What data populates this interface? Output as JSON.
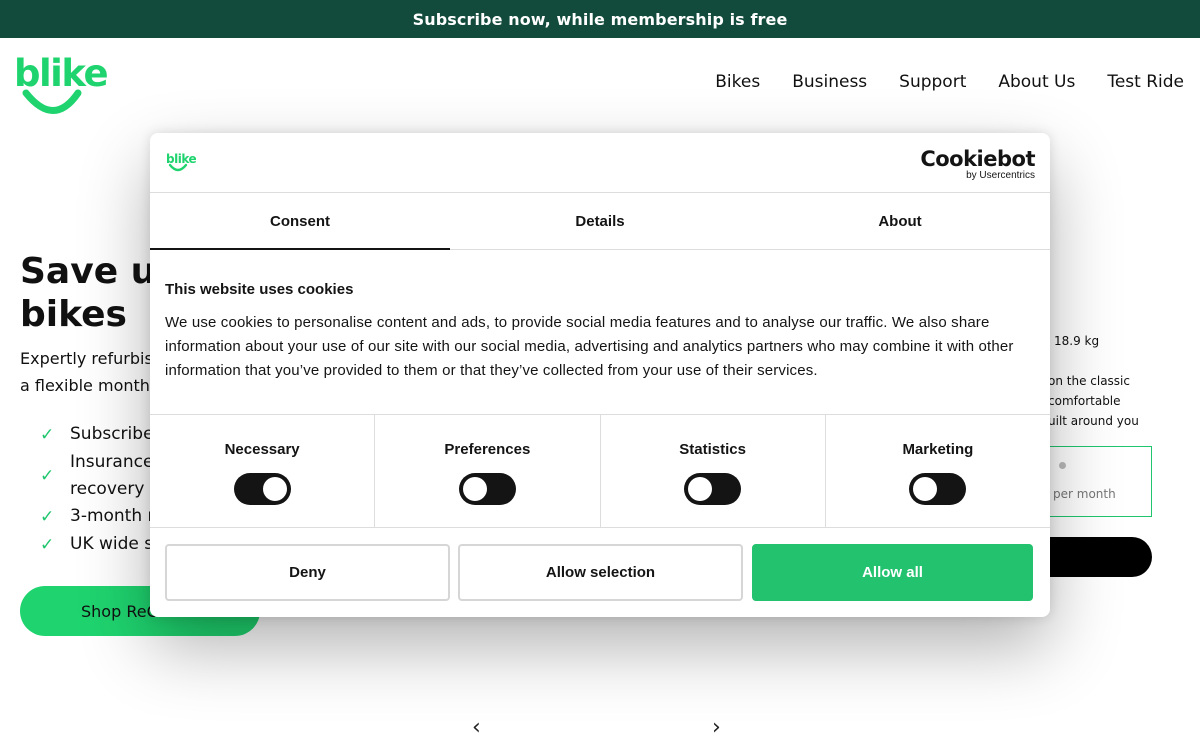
{
  "banner": {
    "text": "Subscribe now, while membership is free"
  },
  "logo": {
    "text": "blike",
    "color": "#1fd46f"
  },
  "nav": {
    "items": [
      "Bikes",
      "Business",
      "Support",
      "About Us",
      "Test Ride"
    ]
  },
  "hero": {
    "title_line1": "Save up",
    "title_line2": "bikes",
    "subtitle_line1": "Expertly refurbis",
    "subtitle_line2": "a flexible month",
    "features": [
      "Subscribe",
      "Insurance",
      "recovery",
      "3-month r",
      "UK wide s"
    ],
    "shop_button": "Shop ReC"
  },
  "product": {
    "weight": "18.9 kg",
    "desc": [
      "on the classic",
      "comfortable",
      "uilt around you"
    ],
    "per_month": "per month"
  },
  "carousel": {
    "prev_icon": "chevron-left-icon",
    "next_icon": "chevron-right-icon"
  },
  "cookie_dialog": {
    "logo_text": "blike",
    "provider_name": "Cookiebot",
    "provider_by": "by Usercentrics",
    "tabs": [
      "Consent",
      "Details",
      "About"
    ],
    "active_tab": "Consent",
    "heading": "This website uses cookies",
    "body": "We use cookies to personalise content and ads, to provide social media features and to analyse our traffic. We also share information about your use of our site with our social media, advertising and analytics partners who may combine it with other information that you’ve provided to them or that they’ve collected from your use of their services.",
    "categories": [
      {
        "label": "Necessary",
        "checked": true
      },
      {
        "label": "Preferences",
        "checked": false
      },
      {
        "label": "Statistics",
        "checked": false
      },
      {
        "label": "Marketing",
        "checked": false
      }
    ],
    "buttons": {
      "deny": "Deny",
      "allow_selection": "Allow selection",
      "allow_all": "Allow all"
    },
    "accent_color": "#22c26e"
  }
}
